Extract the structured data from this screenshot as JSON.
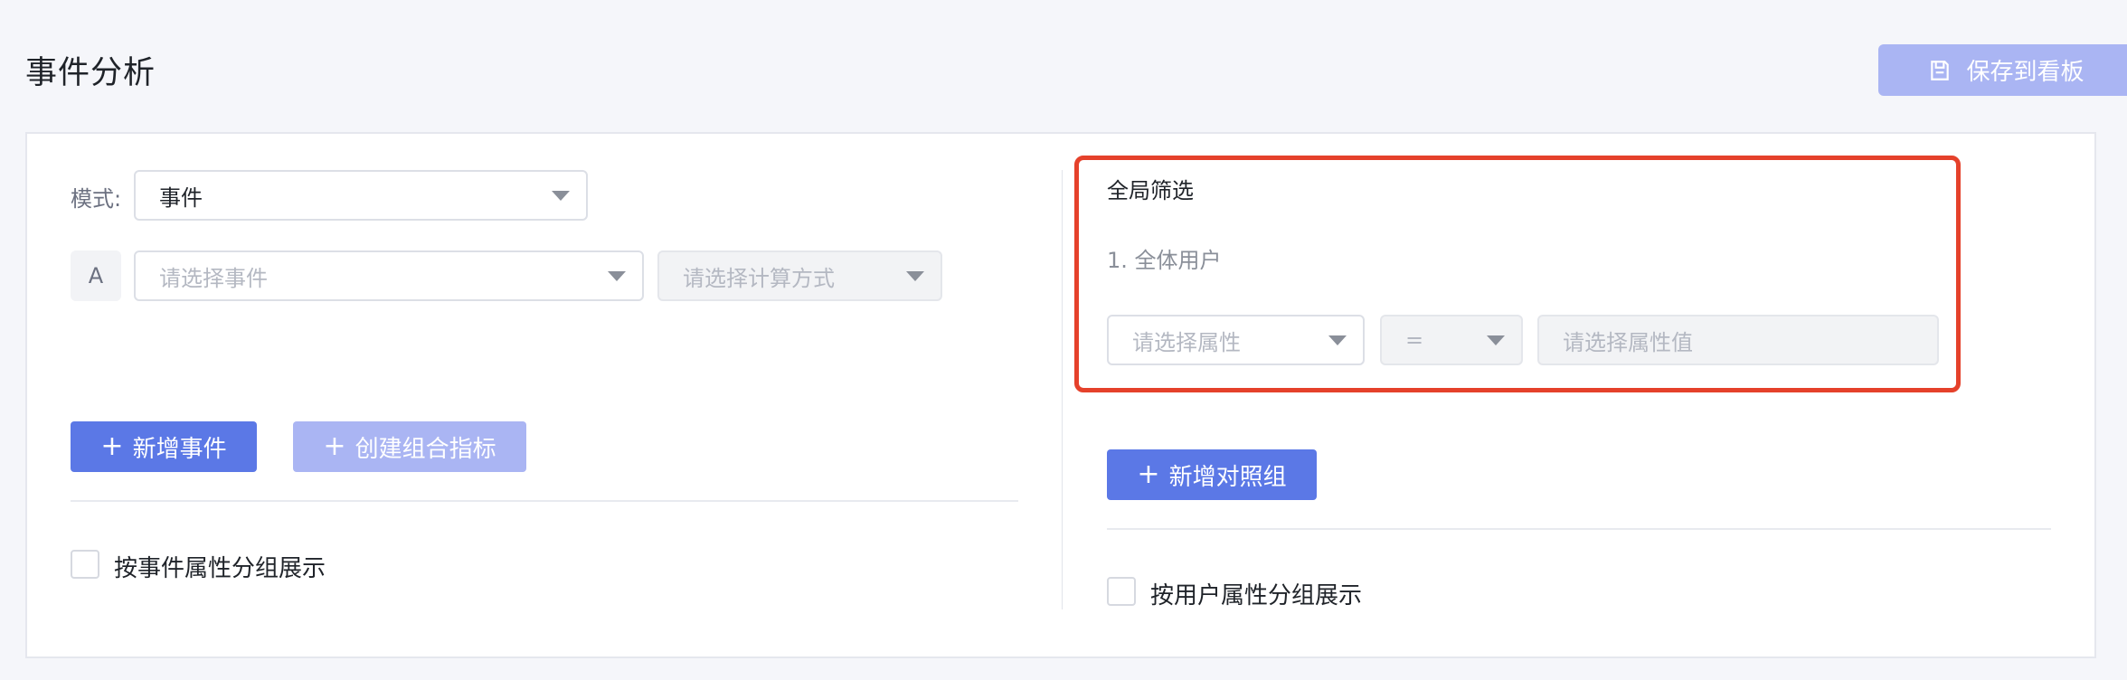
{
  "header": {
    "title": "事件分析",
    "save_button": {
      "label": "保存到看板",
      "icon": "save-icon"
    }
  },
  "left": {
    "mode_label": "模式:",
    "mode_value": "事件",
    "row_badge": "A",
    "event_placeholder": "请选择事件",
    "calc_placeholder": "请选择计算方式",
    "add_event_button": "新增事件",
    "create_metric_button": "创建组合指标",
    "group_by_label": "按事件属性分组展示"
  },
  "right": {
    "title": "全局筛选",
    "group_item": "1. 全体用户",
    "property_placeholder": "请选择属性",
    "operator_value": "=",
    "value_placeholder": "请选择属性值",
    "add_compare_button": "新增对照组",
    "group_by_label": "按用户属性分组展示"
  },
  "colors": {
    "primary": "#5b78e6",
    "primary_disabled": "#aab5f3",
    "highlight": "#e5412b"
  }
}
